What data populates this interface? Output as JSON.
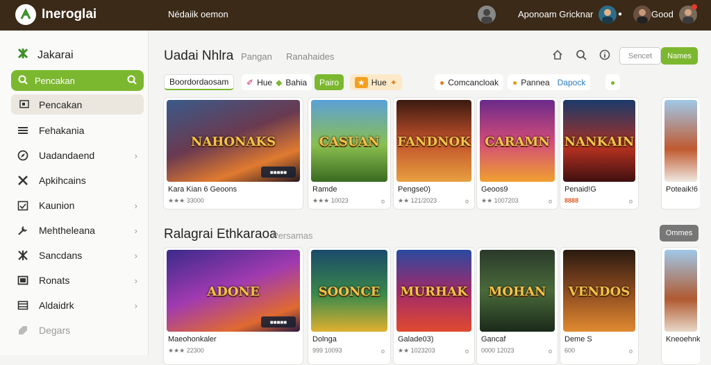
{
  "topbar": {
    "app_title": "Ineroglai",
    "tagline": "Nédaiik oemon",
    "user_name": "Aponoam Gricknar",
    "user2_name": "Good"
  },
  "sidebar": {
    "brand": "Jakarai",
    "search_label": "Pencakan",
    "active_item": "Pencakan",
    "items": [
      {
        "label": "Fehakania",
        "chevron": false
      },
      {
        "label": "Uadandaend",
        "chevron": true
      },
      {
        "label": "Apkihcains",
        "chevron": false
      },
      {
        "label": "Kaunion",
        "chevron": true
      },
      {
        "label": "Mehtheleana",
        "chevron": true
      },
      {
        "label": "Sancdans",
        "chevron": true
      },
      {
        "label": "Ronats",
        "chevron": true
      },
      {
        "label": "Aldaidrk",
        "chevron": true
      },
      {
        "label": "Degars",
        "chevron": false
      }
    ]
  },
  "header": {
    "title": "Uadai Nhlra",
    "sub1": "Pangan",
    "sub2": "Ranahaides",
    "btn_outline": "Sencet",
    "btn_green": "Names"
  },
  "chips": [
    {
      "label": "Boordordaosam"
    },
    {
      "label": "Hue"
    },
    {
      "label": "Bahia"
    },
    {
      "label": "Pairo"
    },
    {
      "label": "Hue"
    },
    {
      "label": "Comcancloak"
    },
    {
      "label": "Pannea"
    },
    {
      "label": "Dapock"
    }
  ],
  "row1": [
    {
      "name": "Kara Kian 6 Geoons",
      "meta": "★★★ 33000",
      "art": "NAHONAKS",
      "badge": "■■■■■",
      "dot": ""
    },
    {
      "name": "Ramde",
      "meta": "★★★ 10023",
      "art": "CASUAN",
      "badge": "",
      "dot": "o"
    },
    {
      "name": "Pengse0)",
      "meta": "★★ 121/2023",
      "art": "FANDNOK",
      "badge": "",
      "dot": "o"
    },
    {
      "name": "Geoos9",
      "meta": "★★ 1007203",
      "art": "CARAMN",
      "badge": "",
      "dot": "o"
    },
    {
      "name": "Penaid!G",
      "meta": "8888",
      "art": "NANKAIN",
      "badge": "",
      "dot": "o"
    },
    {
      "name": "Poteaik!6",
      "meta": "",
      "art": "",
      "badge": "",
      "dot": ""
    }
  ],
  "section2": {
    "title": "Ralagrai Ethkaraoa",
    "sub": "Persamas",
    "btn": "Ommes"
  },
  "row2": [
    {
      "name": "Maeohonkaler",
      "meta": "★★★ 22300",
      "art": "ADONE",
      "badge": "■■■■■",
      "dot": ""
    },
    {
      "name": "Dolnga",
      "meta": "999 10093",
      "art": "SOONCE",
      "badge": "",
      "dot": "o"
    },
    {
      "name": "Galade03)",
      "meta": "★★ 1023203",
      "art": "MURHAK",
      "badge": "",
      "dot": "o"
    },
    {
      "name": "Gancaf",
      "meta": "0000 12023",
      "art": "MOHAN",
      "badge": "",
      "dot": "o"
    },
    {
      "name": "Deme S",
      "meta": "600",
      "art": "VENDOS",
      "badge": "",
      "dot": "o"
    },
    {
      "name": "Kneoehnkt",
      "meta": "",
      "art": "",
      "badge": "",
      "dot": ""
    }
  ]
}
